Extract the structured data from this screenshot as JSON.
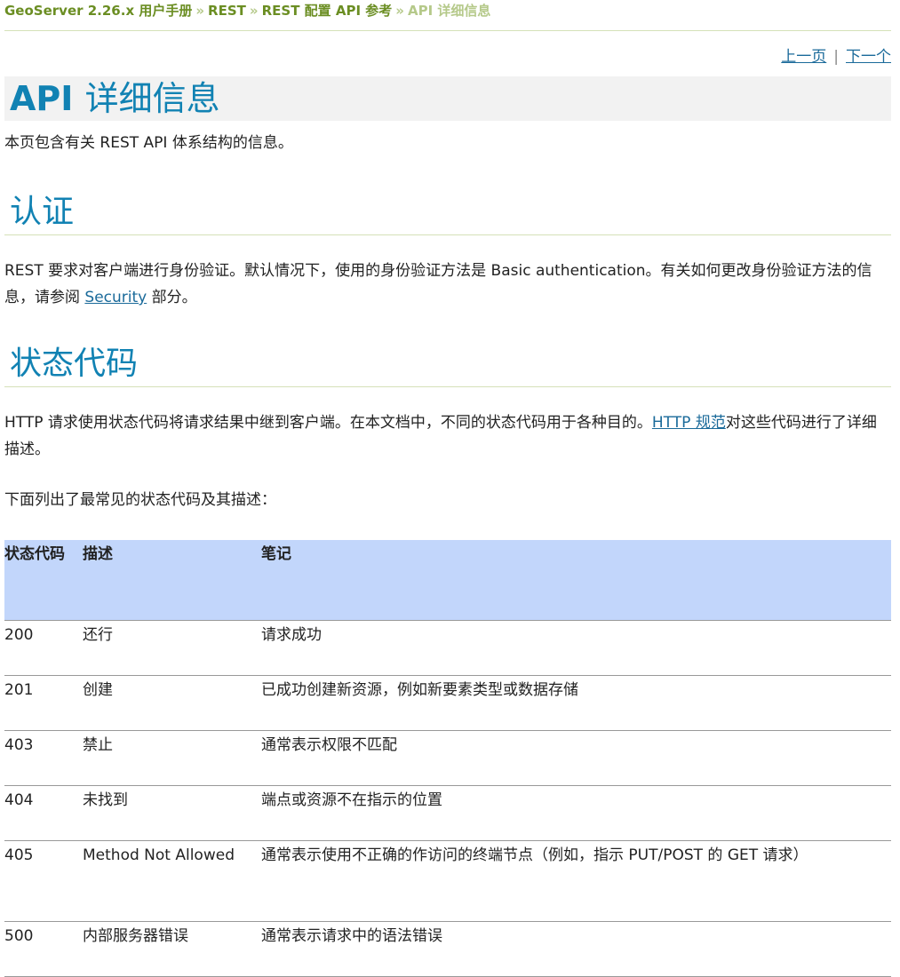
{
  "breadcrumb": {
    "items": [
      "GeoServer 2.26.x 用户手册",
      "REST",
      "REST 配置 API 参考"
    ],
    "current": "API 详细信息",
    "separator": "»"
  },
  "nav": {
    "prev": "上一页",
    "divider": "|",
    "next": "下一个"
  },
  "page_title": {
    "bold": "API",
    "rest": "详细信息"
  },
  "intro": "本页包含有关 REST API 体系结构的信息。",
  "auth": {
    "heading": "认证",
    "text_before": "REST 要求对客户端进行身份验证。默认情况下，使用的身份验证方法是 Basic authentication。有关如何更改身份验证方法的信息，请参阅 ",
    "link": "Security",
    "text_after": " 部分。"
  },
  "status": {
    "heading": "状态代码",
    "text_before": "HTTP 请求使用状态代码将请求结果中继到客户端。在本文档中，不同的状态代码用于各种目的。",
    "link": "HTTP 规范",
    "text_after": "对这些代码进行了详细描述。",
    "list_intro": "下面列出了最常见的状态代码及其描述："
  },
  "table": {
    "headers": [
      "状态代码",
      "描述",
      "笔记"
    ],
    "rows": [
      {
        "code": "200",
        "desc": "还行",
        "note": "请求成功"
      },
      {
        "code": "201",
        "desc": "创建",
        "note": "已成功创建新资源，例如新要素类型或数据存储"
      },
      {
        "code": "403",
        "desc": "禁止",
        "note": "通常表示权限不匹配"
      },
      {
        "code": "404",
        "desc": "未找到",
        "note": "端点或资源不在指示的位置"
      },
      {
        "code": "405",
        "desc": "Method Not Allowed",
        "note": "通常表示使用不正确的作访问的终端节点（例如，指示 PUT/POST 的 GET 请求）"
      },
      {
        "code": "500",
        "desc": "内部服务器错误",
        "note": "通常表示请求中的语法错误"
      }
    ]
  },
  "colors": {
    "heading": "#1182b3",
    "breadcrumb": "#6b8e23",
    "table_header_bg": "#c2d6fb",
    "link": "#1a6a9a"
  }
}
